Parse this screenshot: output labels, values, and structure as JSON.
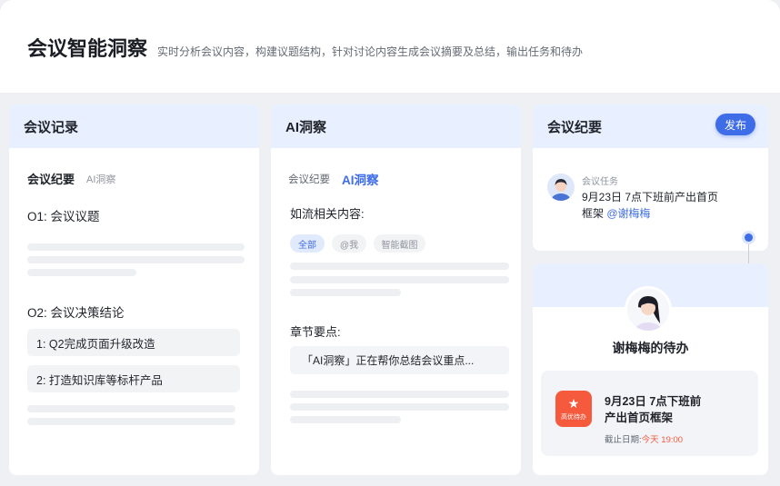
{
  "header": {
    "title": "会议智能洞察",
    "subtitle": "实时分析会议内容，构建议题结构，针对讨论内容生成会议摘要及总结，输出任务和待办"
  },
  "records": {
    "title": "会议记录",
    "tab_active": "会议纪要",
    "tab_other": "AI洞察",
    "topic1": "O1: 会议议题",
    "topic2": "O2: 会议决策结论",
    "items": [
      "1: Q2完成页面升级改造",
      "2: 打造知识库等标杆产品"
    ]
  },
  "insight": {
    "title": "AI洞察",
    "tab_other": "会议纪要",
    "tab_active": "AI洞察",
    "related_label": "如流相关内容:",
    "chips": [
      "全部",
      "@我",
      "智能截图"
    ],
    "section_label": "章节要点:",
    "summary_text": "「AI洞察」正在帮你总结会议重点..."
  },
  "minutes": {
    "title": "会议纪要",
    "publish_label": "发布",
    "task_tag": "会议任务",
    "task_text": "9月23日 7点下班前产出首页",
    "task_text2": "框架",
    "mention": "@谢梅梅"
  },
  "todo": {
    "owner_title": "谢梅梅的待办",
    "badge_label": "高优待办",
    "task_line1": "9月23日 7点下班前",
    "task_line2": "产出首页框架",
    "deadline_label": "截止日期:",
    "deadline_value": "今天 19:00"
  },
  "colors": {
    "accent": "#3f6de8",
    "header_bg": "#e8effe",
    "urgent": "#f55a3d"
  }
}
